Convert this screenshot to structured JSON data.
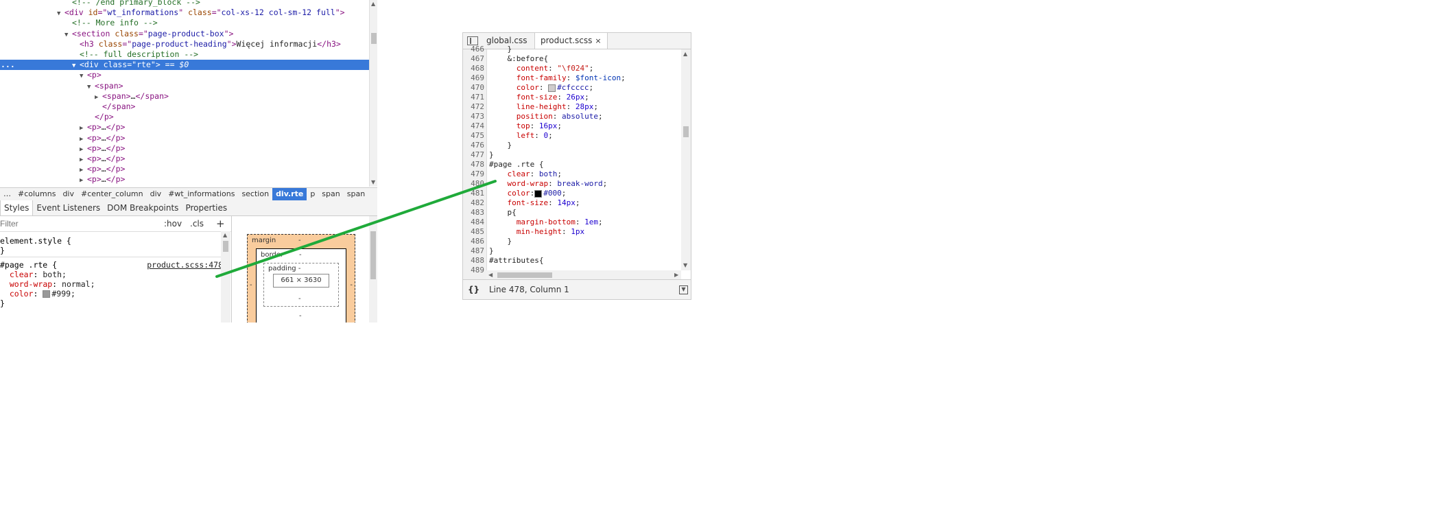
{
  "dom": {
    "lines": [
      {
        "indent": 9,
        "tri": "",
        "html": [
          [
            "comment",
            "<!-- /end primary_block -->"
          ]
        ]
      },
      {
        "indent": 8,
        "tri": "▼",
        "html": [
          [
            "tag",
            "<div "
          ],
          [
            "attr",
            "id"
          ],
          [
            "tag",
            "=\""
          ],
          [
            "val",
            "wt_informations"
          ],
          [
            "tag",
            "\" "
          ],
          [
            "attr",
            "class"
          ],
          [
            "tag",
            "=\""
          ],
          [
            "val",
            "col-xs-12 col-sm-12 full"
          ],
          [
            "tag",
            "\">"
          ]
        ]
      },
      {
        "indent": 9,
        "tri": "",
        "html": [
          [
            "comment",
            "<!-- More info -->"
          ]
        ]
      },
      {
        "indent": 9,
        "tri": "▼",
        "html": [
          [
            "tag",
            "<section "
          ],
          [
            "attr",
            "class"
          ],
          [
            "tag",
            "=\""
          ],
          [
            "val",
            "page-product-box"
          ],
          [
            "tag",
            "\">"
          ]
        ]
      },
      {
        "indent": 10,
        "tri": "",
        "html": [
          [
            "tag",
            "<h3 "
          ],
          [
            "attr",
            "class"
          ],
          [
            "tag",
            "=\""
          ],
          [
            "val",
            "page-product-heading"
          ],
          [
            "tag",
            "\">"
          ],
          [
            "txt",
            "Więcej informacji"
          ],
          [
            "tag",
            "</h3>"
          ]
        ]
      },
      {
        "indent": 10,
        "tri": "",
        "html": [
          [
            "comment",
            "<!-- full description -->"
          ]
        ]
      },
      {
        "indent": 10,
        "tri": "▼",
        "selected": true,
        "html": [
          [
            "tag",
            "<div "
          ],
          [
            "attr",
            "class"
          ],
          [
            "tag",
            "=\""
          ],
          [
            "val",
            "rte"
          ],
          [
            "tag",
            "\">"
          ],
          [
            "dollar",
            " == $0"
          ]
        ]
      },
      {
        "indent": 11,
        "tri": "▼",
        "html": [
          [
            "tag",
            "<p>"
          ]
        ]
      },
      {
        "indent": 12,
        "tri": "▼",
        "html": [
          [
            "tag",
            "<span>"
          ]
        ]
      },
      {
        "indent": 13,
        "tri": "▶",
        "html": [
          [
            "tag",
            "<span>"
          ],
          [
            "txt",
            "…"
          ],
          [
            "tag",
            "</span>"
          ]
        ]
      },
      {
        "indent": 13,
        "tri": "",
        "html": [
          [
            "tag",
            "</span>"
          ]
        ]
      },
      {
        "indent": 12,
        "tri": "",
        "html": [
          [
            "tag",
            "</p>"
          ]
        ]
      },
      {
        "indent": 11,
        "tri": "▶",
        "html": [
          [
            "tag",
            "<p>"
          ],
          [
            "txt",
            "…"
          ],
          [
            "tag",
            "</p>"
          ]
        ]
      },
      {
        "indent": 11,
        "tri": "▶",
        "html": [
          [
            "tag",
            "<p>"
          ],
          [
            "txt",
            "…"
          ],
          [
            "tag",
            "</p>"
          ]
        ]
      },
      {
        "indent": 11,
        "tri": "▶",
        "html": [
          [
            "tag",
            "<p>"
          ],
          [
            "txt",
            "…"
          ],
          [
            "tag",
            "</p>"
          ]
        ]
      },
      {
        "indent": 11,
        "tri": "▶",
        "html": [
          [
            "tag",
            "<p>"
          ],
          [
            "txt",
            "…"
          ],
          [
            "tag",
            "</p>"
          ]
        ]
      },
      {
        "indent": 11,
        "tri": "▶",
        "html": [
          [
            "tag",
            "<p>"
          ],
          [
            "txt",
            "…"
          ],
          [
            "tag",
            "</p>"
          ]
        ]
      },
      {
        "indent": 11,
        "tri": "▶",
        "html": [
          [
            "tag",
            "<p>"
          ],
          [
            "txt",
            "…"
          ],
          [
            "tag",
            "</p>"
          ]
        ]
      }
    ],
    "selected_marker": "..."
  },
  "breadcrumbs": [
    "…",
    "#columns",
    "div",
    "#center_column",
    "div",
    "#wt_informations",
    "section",
    "div.rte",
    "p",
    "span",
    "span"
  ],
  "breadcrumb_active": 7,
  "panel_tabs": [
    "Styles",
    "Event Listeners",
    "DOM Breakpoints",
    "Properties"
  ],
  "styles": {
    "filter_placeholder": "Filter",
    "hov": ":hov",
    "cls": ".cls",
    "add": "+",
    "element_style_open": "element.style {",
    "element_style_close": "}",
    "rule_selector": "#page .rte {",
    "rule_source": "product.scss:478",
    "rule_props": [
      {
        "name": "clear",
        "value": "both;"
      },
      {
        "name": "word-wrap",
        "value": "normal;"
      },
      {
        "name": "color",
        "value": "#999;",
        "swatch": "#999999"
      }
    ],
    "rule_close": "}"
  },
  "box_model": {
    "margin_label": "margin",
    "border_label": "border",
    "padding_label": "padding -",
    "content": "661 × 3630",
    "dash": "-"
  },
  "sources": {
    "tabs": [
      {
        "label": "global.css",
        "active": false
      },
      {
        "label": "product.scss",
        "active": true
      }
    ],
    "close": "×",
    "lines": [
      {
        "num": "466",
        "code": [
          [
            "kw",
            "    }"
          ]
        ]
      },
      {
        "num": "467",
        "code": [
          [
            "kw",
            "    &:before{"
          ]
        ]
      },
      {
        "num": "468",
        "code": [
          [
            "cprop",
            "      content"
          ],
          [
            "kw",
            ": "
          ],
          [
            "cstr",
            "\"\\f024\""
          ],
          [
            "kw",
            ";"
          ]
        ]
      },
      {
        "num": "469",
        "code": [
          [
            "cprop",
            "      font-family"
          ],
          [
            "kw",
            ": "
          ],
          [
            "cvar",
            "$font-icon"
          ],
          [
            "kw",
            ";"
          ]
        ]
      },
      {
        "num": "470",
        "code": [
          [
            "cprop",
            "      color"
          ],
          [
            "kw",
            ": "
          ],
          [
            "swatch",
            "#cfcccc"
          ],
          [
            "cval",
            "#cfcccc"
          ],
          [
            "kw",
            ";"
          ]
        ]
      },
      {
        "num": "471",
        "code": [
          [
            "cprop",
            "      font-size"
          ],
          [
            "kw",
            ": "
          ],
          [
            "cnum",
            "26px"
          ],
          [
            "kw",
            ";"
          ]
        ]
      },
      {
        "num": "472",
        "code": [
          [
            "cprop",
            "      line-height"
          ],
          [
            "kw",
            ": "
          ],
          [
            "cnum",
            "28px"
          ],
          [
            "kw",
            ";"
          ]
        ]
      },
      {
        "num": "473",
        "code": [
          [
            "cprop",
            "      position"
          ],
          [
            "kw",
            ": "
          ],
          [
            "cval",
            "absolute"
          ],
          [
            "kw",
            ";"
          ]
        ]
      },
      {
        "num": "474",
        "code": [
          [
            "cprop",
            "      top"
          ],
          [
            "kw",
            ": "
          ],
          [
            "cnum",
            "16px"
          ],
          [
            "kw",
            ";"
          ]
        ]
      },
      {
        "num": "475",
        "code": [
          [
            "cprop",
            "      left"
          ],
          [
            "kw",
            ": "
          ],
          [
            "cnum",
            "0"
          ],
          [
            "kw",
            ";"
          ]
        ]
      },
      {
        "num": "476",
        "code": [
          [
            "kw",
            "    }"
          ]
        ]
      },
      {
        "num": "477",
        "code": [
          [
            "kw",
            "}"
          ]
        ]
      },
      {
        "num": "478",
        "code": [
          [
            "kw",
            "#page .rte {"
          ]
        ]
      },
      {
        "num": "479",
        "code": [
          [
            "cprop",
            "    clear"
          ],
          [
            "kw",
            ": "
          ],
          [
            "cval",
            "both"
          ],
          [
            "kw",
            ";"
          ]
        ]
      },
      {
        "num": "480",
        "code": [
          [
            "cprop",
            "    word-wrap"
          ],
          [
            "kw",
            ": "
          ],
          [
            "cval",
            "break-word"
          ],
          [
            "kw",
            ";"
          ]
        ]
      },
      {
        "num": "481",
        "code": [
          [
            "cprop",
            "    color"
          ],
          [
            "kw",
            ":"
          ],
          [
            "swatch",
            "#000000"
          ],
          [
            "cval",
            "#000"
          ],
          [
            "kw",
            ";"
          ]
        ]
      },
      {
        "num": "482",
        "code": [
          [
            "cprop",
            "    font-size"
          ],
          [
            "kw",
            ": "
          ],
          [
            "cnum",
            "14px"
          ],
          [
            "kw",
            ";"
          ]
        ]
      },
      {
        "num": "483",
        "code": [
          [
            "kw",
            "    p{"
          ]
        ]
      },
      {
        "num": "484",
        "code": [
          [
            "cprop",
            "      margin-bottom"
          ],
          [
            "kw",
            ": "
          ],
          [
            "cnum",
            "1em"
          ],
          [
            "kw",
            ";"
          ]
        ]
      },
      {
        "num": "485",
        "code": [
          [
            "cprop",
            "      min-height"
          ],
          [
            "kw",
            ": "
          ],
          [
            "cnum",
            "1px"
          ]
        ]
      },
      {
        "num": "486",
        "code": [
          [
            "kw",
            "    }"
          ]
        ]
      },
      {
        "num": "487",
        "code": [
          [
            "kw",
            "}"
          ]
        ]
      },
      {
        "num": "488",
        "code": [
          [
            "kw",
            "#attributes{"
          ]
        ]
      },
      {
        "num": "489",
        "code": [
          [
            "kw",
            ""
          ]
        ]
      }
    ],
    "pretty_print": "{}",
    "cursor_position": "Line 478, Column 1"
  },
  "colors": {
    "selection": "#3879d9",
    "annotation_line": "#1faa3a"
  }
}
